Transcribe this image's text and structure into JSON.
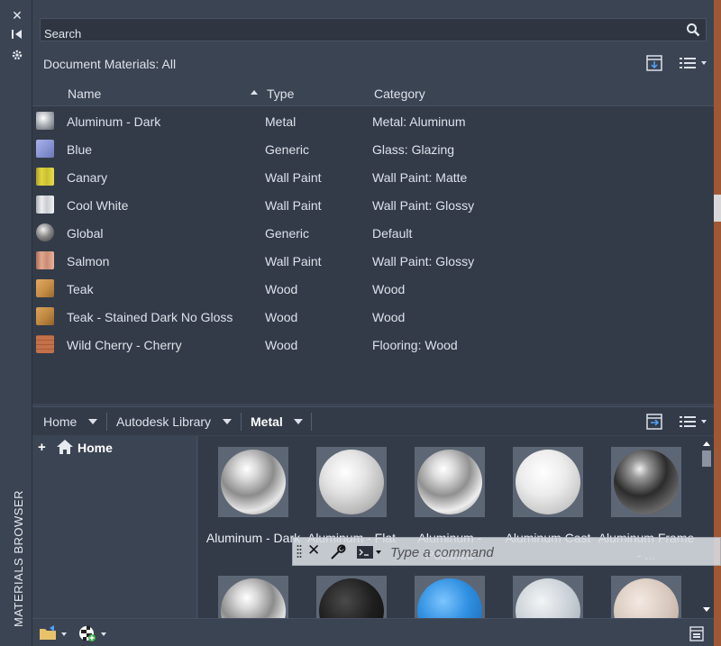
{
  "palette": {
    "title": "MATERIALS BROWSER",
    "close_icon": "close-icon",
    "autohide_icon": "autohide-icon",
    "properties_icon": "gear-icon"
  },
  "search": {
    "placeholder": "Search"
  },
  "document": {
    "title": "Document Materials: All",
    "columns": {
      "name": "Name",
      "type": "Type",
      "category": "Category"
    },
    "materials": [
      {
        "name": "Aluminum - Dark",
        "type": "Metal",
        "category": "Metal: Aluminum",
        "color": "#9aa0a8"
      },
      {
        "name": "Blue",
        "type": "Generic",
        "category": "Glass: Glazing",
        "color": "#8f9ad6"
      },
      {
        "name": "Canary",
        "type": "Wall Paint",
        "category": "Wall Paint: Matte",
        "color": "#d4c93a"
      },
      {
        "name": "Cool White",
        "type": "Wall Paint",
        "category": "Wall Paint: Glossy",
        "color": "#dfe2e6"
      },
      {
        "name": "Global",
        "type": "Generic",
        "category": "Default",
        "color": "#8a8a8a"
      },
      {
        "name": "Salmon",
        "type": "Wall Paint",
        "category": "Wall Paint: Glossy",
        "color": "#d49a82"
      },
      {
        "name": "Teak",
        "type": "Wood",
        "category": "Wood",
        "color": "#c8924a"
      },
      {
        "name": "Teak - Stained Dark No Gloss",
        "type": "Wood",
        "category": "Wood",
        "color": "#b98242"
      },
      {
        "name": "Wild Cherry - Cherry",
        "type": "Wood",
        "category": "Flooring: Wood",
        "color": "#b8643e"
      }
    ]
  },
  "library": {
    "breadcrumbs": [
      "Home",
      "Autodesk Library",
      "Metal"
    ],
    "tree_root": "Home",
    "tiles": [
      {
        "name": "Aluminum - Dark",
        "ball": "radial-gradient(circle at 40% 30%, #ffffff 0%, #d8d8d8 18%, #8c8c8c 45%, #e6e6e6 70%, #6a6a6a 100%)"
      },
      {
        "name": "Aluminum - Flat",
        "ball": "radial-gradient(circle at 40% 35%, #ffffff 0%, #e4e4e4 35%, #b9b9b9 70%, #8f8f8f 100%)"
      },
      {
        "name": "Aluminum - Polished",
        "ball": "radial-gradient(circle at 40% 30%, #ffffff 0%, #dcdcdc 18%, #909090 45%, #eeeeee 70%, #707070 100%)"
      },
      {
        "name": "Aluminum Cast",
        "ball": "radial-gradient(circle at 42% 35%, #ffffff 0%, #ececec 40%, #c8c8c8 75%, #a4a4a4 100%)"
      },
      {
        "name": "Aluminum Frame - ...",
        "ball": "radial-gradient(circle at 40% 30%, #f0f0f0 0%, #9a9a9a 15%, #2c2c2c 45%, #6a6a6a 75%, #151515 100%)"
      },
      {
        "name": "",
        "ball": "radial-gradient(circle at 40% 30%, #ffffff 0%, #d8d8d8 18%, #8c8c8c 45%, #e6e6e6 70%, #6a6a6a 100%)"
      },
      {
        "name": "",
        "ball": "radial-gradient(circle at 40% 35%, #4a4a4a 0%, #1e1e1e 50%, #0c0c0c 100%)"
      },
      {
        "name": "",
        "ball": "radial-gradient(circle at 40% 35%, #7cc4ff 0%, #2f8fe0 45%, #1a5fa8 100%)"
      },
      {
        "name": "",
        "ball": "radial-gradient(circle at 40% 35%, #f2f4f6 0%, #c9d0d6 50%, #9aa3ab 100%)"
      },
      {
        "name": "",
        "ball": "radial-gradient(circle at 40% 35%, #f3e9e2 0%, #d8c8bd 50%, #b3a296 100%)"
      }
    ]
  },
  "command_line": {
    "placeholder": "Type a command"
  }
}
